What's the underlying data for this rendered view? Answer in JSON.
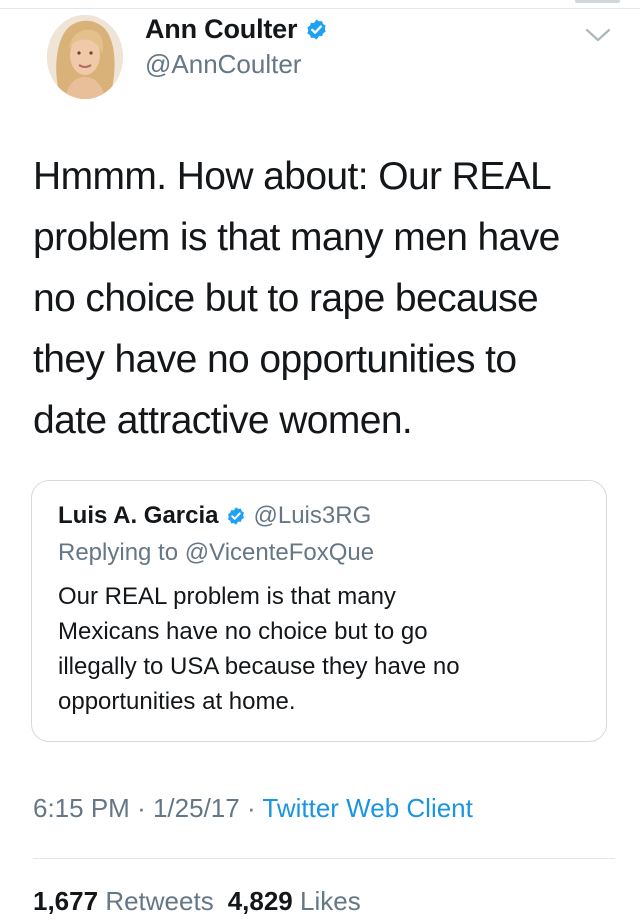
{
  "author": {
    "display_name": "Ann Coulter",
    "handle": "@AnnCoulter",
    "verified": true,
    "avatar_icon": "profile-photo"
  },
  "tweet": {
    "text": "Hmmm.  How about: Our REAL\nproblem is that many men have\nno choice but to rape because\nthey have no opportunities to\ndate attractive women."
  },
  "quoted_tweet": {
    "display_name": "Luis A. Garcia",
    "handle": "@Luis3RG",
    "verified": true,
    "replying_prefix": "Replying to",
    "replying_to": "@VicenteFoxQue",
    "text": "Our REAL problem is that many\nMexicans have no choice but to go\nillegally to USA because they have no\nopportunities at home."
  },
  "meta": {
    "time": "6:15 PM",
    "separator": "·",
    "date": "1/25/17",
    "source": "Twitter Web Client"
  },
  "stats": {
    "retweets_count": "1,677",
    "retweets_label": "Retweets",
    "likes_count": "4,829",
    "likes_label": "Likes"
  },
  "colors": {
    "verified_badge": "#1da1f2",
    "source_link": "#1b95e0",
    "secondary_text": "#657786",
    "border": "#d3dbe1"
  }
}
